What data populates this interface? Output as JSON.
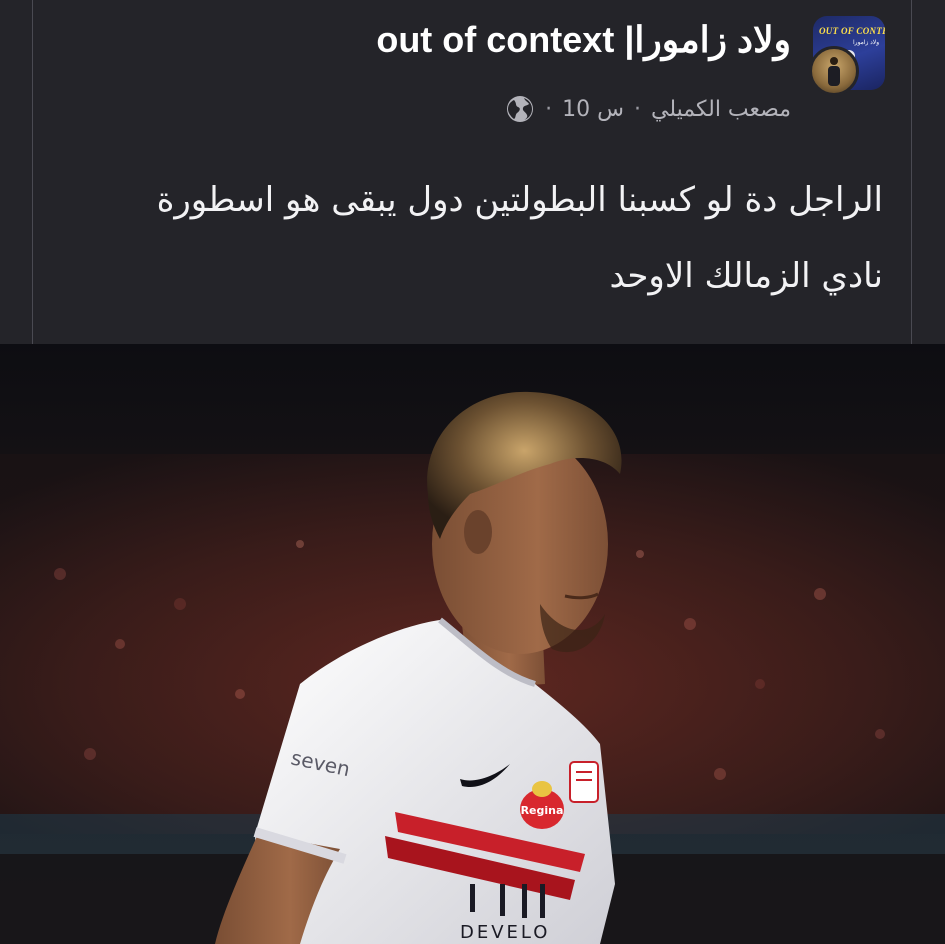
{
  "post": {
    "group_title": "ولاد زامورا| out of context",
    "author_name": "مصعب الكميلي",
    "time": "10 س",
    "separator": "·",
    "privacy_icon": "globe-icon",
    "text": "الراجل دة لو كسبنا البطولتين دول يبقى هو اسطورة نادي الزمالك الاوحد"
  },
  "group_avatar": {
    "label": "OUT OF CONTEXT",
    "sublabel": "ولاد زامورا"
  },
  "photo": {
    "description_icon": "football-player-photo",
    "jersey_sponsor": "Regina",
    "jersey_sleeve": "seven",
    "jersey_front": "DEVELO"
  },
  "colors": {
    "background": "#24242a",
    "card_border": "#4a4a52",
    "text_primary": "#ffffff",
    "text_secondary": "#b3b3ba",
    "jersey_white": "#f2f2f4",
    "jersey_red": "#c8202a"
  }
}
